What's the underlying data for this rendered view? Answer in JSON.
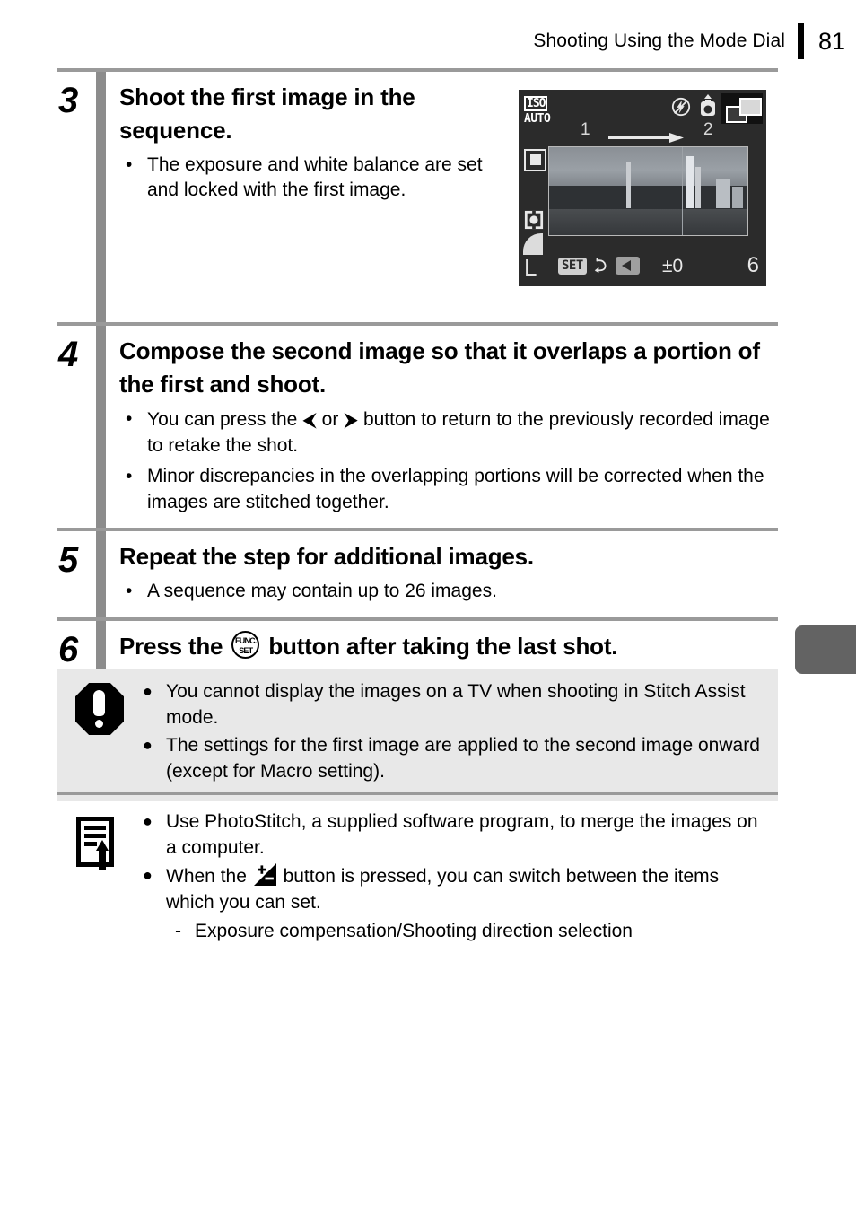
{
  "header": {
    "title": "Shooting Using the Mode Dial",
    "page_number": "81"
  },
  "steps": [
    {
      "number": "3",
      "title": "Shoot the first image in the sequence.",
      "bullets": [
        "The exposure and white balance are set and locked with the first image."
      ]
    },
    {
      "number": "4",
      "title_part1": "Compose the second image so that it overlaps a portion of the first and shoot.",
      "bullets": [
        {
          "text_before": "You can press the",
          "icon_left": "left-arrow-icon",
          "text_middle": "or",
          "icon_right": "right-arrow-icon",
          "text_after": "button to return to the previously recorded image to retake the shot."
        },
        {
          "text": "Minor discrepancies in the overlapping portions will be corrected when the images are stitched together."
        }
      ]
    },
    {
      "number": "5",
      "title": "Repeat the step for additional images.",
      "bullets": [
        "A sequence may contain up to 26 images."
      ]
    },
    {
      "number": "6",
      "title_before": "Press the",
      "title_icon": "func-set-button-icon",
      "title_after": "button after taking the last shot.",
      "func_label_top": "FUNC.",
      "func_label_bottom": "SET"
    }
  ],
  "lcd_screen": {
    "iso_label": "ISO",
    "iso_value": "AUTO",
    "sequence_first": "1",
    "sequence_second": "2",
    "image_size": "L",
    "set_label": "SET",
    "exposure_value": "±0",
    "shots_remaining": "6",
    "icons": [
      "flash-off-icon",
      "camera-shake-warning-icon",
      "stitch-assist-mode-icon",
      "af-frame-icon",
      "metering-icon",
      "image-quality-icon",
      "return-arrow-icon",
      "left-direction-button-icon",
      "direction-arrow-icon"
    ]
  },
  "caution_box": {
    "icon": "exclamation-octagon-icon",
    "bullets": [
      "You cannot display the images on a TV when shooting in Stitch Assist mode.",
      "The settings for the first image are applied to the second image onward (except for Macro setting)."
    ]
  },
  "note_box": {
    "icon": "note-pencil-icon",
    "bullets": [
      {
        "text": "Use PhotoStitch, a supplied software program, to merge the images on a computer."
      },
      {
        "text_before": "When the",
        "icon": "exposure-compensation-icon",
        "text_after": "button is pressed, you can switch between the items which you can set."
      }
    ],
    "sub_item": "Exposure compensation/Shooting direction selection",
    "sub_dash": "-"
  },
  "colors": {
    "step_bar": "#8c8c8c",
    "rule": "#9a9a9a",
    "caution_bg": "#e8e8e8",
    "side_tab": "#636363",
    "lcd_bg": "#2b2b2b"
  },
  "glyphs": {
    "bullet_dot": "•",
    "filled_dot": "●",
    "left_arrow": "⮜",
    "right_arrow": "⮞"
  }
}
